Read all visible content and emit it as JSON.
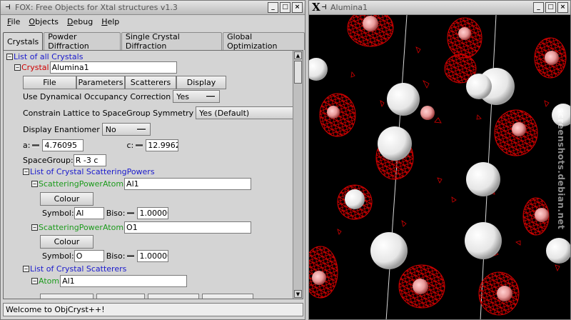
{
  "left_window": {
    "title": "FOX: Free Objects for Xtal structures v1.3",
    "icon": "pin-icon",
    "menu": [
      {
        "label": "File",
        "accel": "F",
        "rest": "ile"
      },
      {
        "label": "Objects",
        "accel": "O",
        "rest": "bjects"
      },
      {
        "label": "Debug",
        "accel": "D",
        "rest": "ebug"
      },
      {
        "label": "Help",
        "accel": "H",
        "rest": "elp"
      }
    ],
    "tabs": [
      "Crystals",
      "Powder Diffraction",
      "Single Crystal Diffraction",
      "Global Optimization"
    ],
    "active_tab": "Crystals",
    "tree": {
      "list_all_label": "List of all Crystals",
      "crystal_label": "Crystal",
      "crystal_name": "Alumina1",
      "buttons": [
        "File",
        "Parameters",
        "Scatterers",
        "Display"
      ],
      "dyn_occ_label": "Use Dynamical Occupancy Correction",
      "dyn_occ_value": "Yes",
      "constrain_label": "Constrain Lattice to SpaceGroup Symmetry",
      "constrain_value": "Yes (Default)",
      "enantiomer_label": "Display Enantiomer",
      "enantiomer_value": "No",
      "a_label": "a:",
      "a_value": "4.76095",
      "c_label": "c:",
      "c_value": "12.9962",
      "spacegroup_label": "SpaceGroup:",
      "spacegroup_value": "R -3 c",
      "scattpowers_label": "List of Crystal ScatteringPowers",
      "powers": [
        {
          "label": "ScatteringPowerAtom",
          "name": "Al1",
          "colour_btn": "Colour",
          "symbol_label": "Symbol:",
          "symbol": "Al",
          "biso_label": "Biso:",
          "biso": "1.00000"
        },
        {
          "label": "ScatteringPowerAtom",
          "name": "O1",
          "colour_btn": "Colour",
          "symbol_label": "Symbol:",
          "symbol": "O",
          "biso_label": "Biso:",
          "biso": "1.00000"
        }
      ],
      "scatterers_label": "List of Crystal Scatterers",
      "atom_label": "Atom",
      "atom_name": "Al1"
    },
    "status": "Welcome to ObjCryst++!"
  },
  "right_window": {
    "title": "Alumina1",
    "icon": "x-logo-icon",
    "watermark": "screenshots.debian.net"
  },
  "colors": {
    "link_blue": "#1a1acc",
    "link_red": "#d00000",
    "link_green": "#1d9b1d",
    "density_red": "#d10000",
    "atom_white": "#f4f4f4"
  }
}
